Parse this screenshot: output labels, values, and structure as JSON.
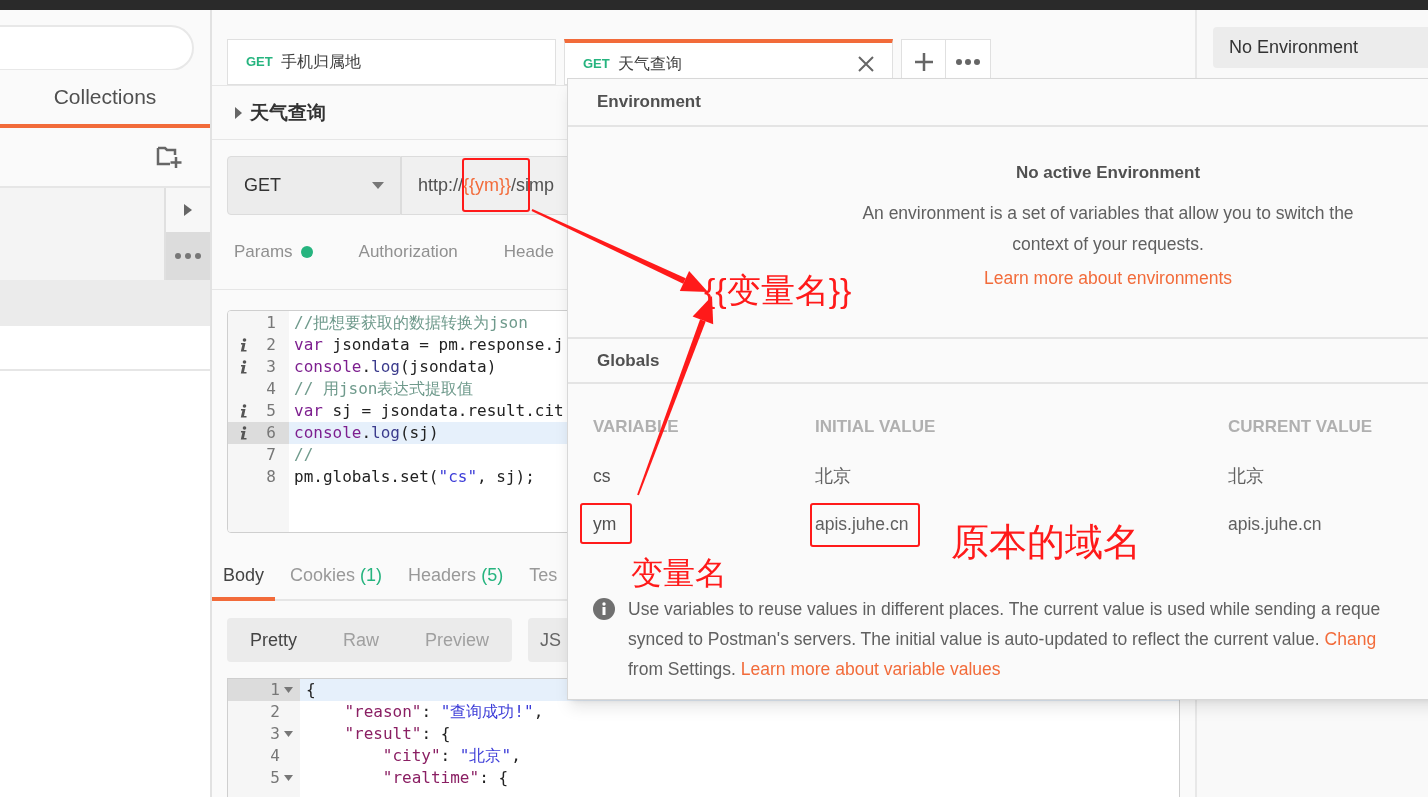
{
  "sidebar": {
    "tab": {
      "label": "Collections",
      "selected": true
    }
  },
  "request_tabs": [
    {
      "method": "GET",
      "name": "手机归属地",
      "selected": false,
      "closable": false
    },
    {
      "method": "GET",
      "name": "天气查询",
      "selected": true,
      "closable": true
    }
  ],
  "request": {
    "name": "天气查询",
    "method": "GET",
    "url_parts": [
      {
        "text": "http://",
        "kind": "plain"
      },
      {
        "text": "{{ym}}",
        "kind": "variable"
      },
      {
        "text": "/simp",
        "kind": "plain"
      }
    ]
  },
  "request_sections": [
    {
      "label": "Params",
      "indicator": true
    },
    {
      "label": "Authorization",
      "indicator": false
    },
    {
      "label": "Heade",
      "indicator": false
    }
  ],
  "script_lines": [
    {
      "number": "1",
      "info": false,
      "active": false,
      "tokens": [
        {
          "text": "//把想要获取的数据转换为json",
          "kind": "comment"
        }
      ]
    },
    {
      "number": "2",
      "info": true,
      "active": false,
      "tokens": [
        {
          "text": "var",
          "kind": "keyword"
        },
        {
          "text": " jsondata = pm.response.j",
          "kind": "plain"
        }
      ]
    },
    {
      "number": "3",
      "info": true,
      "active": false,
      "tokens": [
        {
          "text": "console",
          "kind": "keyword"
        },
        {
          "text": ".",
          "kind": "plain"
        },
        {
          "text": "log",
          "kind": "property"
        },
        {
          "text": "(jsondata)",
          "kind": "plain"
        }
      ]
    },
    {
      "number": "4",
      "info": false,
      "active": false,
      "tokens": [
        {
          "text": "// 用json表达式提取值",
          "kind": "comment"
        }
      ]
    },
    {
      "number": "5",
      "info": true,
      "active": false,
      "tokens": [
        {
          "text": "var",
          "kind": "keyword"
        },
        {
          "text": " sj = jsondata.result.cit",
          "kind": "plain"
        }
      ]
    },
    {
      "number": "6",
      "info": true,
      "active": true,
      "tokens": [
        {
          "text": "console",
          "kind": "keyword"
        },
        {
          "text": ".",
          "kind": "plain"
        },
        {
          "text": "log",
          "kind": "property"
        },
        {
          "text": "(sj)",
          "kind": "plain"
        }
      ]
    },
    {
      "number": "7",
      "info": false,
      "active": false,
      "tokens": [
        {
          "text": "//",
          "kind": "comment"
        }
      ]
    },
    {
      "number": "8",
      "info": false,
      "active": false,
      "tokens": [
        {
          "text": "pm.globals.set(",
          "kind": "plain"
        },
        {
          "text": "\"cs\"",
          "kind": "string"
        },
        {
          "text": ", sj);",
          "kind": "plain"
        }
      ]
    }
  ],
  "response_tabs": [
    {
      "label": "Body",
      "selected": true
    },
    {
      "label": "Cookies",
      "count": "(1)",
      "selected": false
    },
    {
      "label": "Headers",
      "count": "(5)",
      "selected": false
    },
    {
      "label": "Tes",
      "selected": false
    }
  ],
  "view_modes": [
    {
      "label": "Pretty",
      "selected": true
    },
    {
      "label": "Raw",
      "selected": false
    },
    {
      "label": "Preview",
      "selected": false
    }
  ],
  "format": "JS",
  "body_lines": [
    {
      "number": "1",
      "foldable": true,
      "active": true,
      "tokens": [
        {
          "text": "{",
          "kind": "plain"
        }
      ],
      "children": [
        {
          "number": "2",
          "foldable": false,
          "active": false,
          "tokens": [
            {
              "text": "\"reason\"",
              "kind": "key"
            },
            {
              "text": ": ",
              "kind": "plain"
            },
            {
              "text": "\"查询成功!\"",
              "kind": "string"
            },
            {
              "text": ",",
              "kind": "plain"
            }
          ]
        },
        {
          "number": "3",
          "foldable": true,
          "active": false,
          "tokens": [
            {
              "text": "\"result\"",
              "kind": "key"
            },
            {
              "text": ": {",
              "kind": "plain"
            }
          ],
          "children": [
            {
              "number": "4",
              "foldable": false,
              "active": false,
              "tokens": [
                {
                  "text": "\"city\"",
                  "kind": "key"
                },
                {
                  "text": ": ",
                  "kind": "plain"
                },
                {
                  "text": "\"北京\"",
                  "kind": "string"
                },
                {
                  "text": ",",
                  "kind": "plain"
                }
              ]
            },
            {
              "number": "5",
              "foldable": true,
              "active": false,
              "tokens": [
                {
                  "text": "\"realtime\"",
                  "kind": "key"
                },
                {
                  "text": ": {",
                  "kind": "plain"
                }
              ]
            }
          ]
        }
      ]
    }
  ],
  "environment_selector": {
    "value": "No Environment"
  },
  "environment_popup": {
    "title": "Environment",
    "empty_title": "No active Environment",
    "empty_text": "An environment is a set of variables that allow you to switch the context of your requests.",
    "empty_link": "Learn more about environments",
    "globals_title": "Globals",
    "columns": [
      "VARIABLE",
      "INITIAL VALUE",
      "CURRENT VALUE"
    ],
    "rows": [
      [
        "cs",
        "北京",
        "北京"
      ],
      [
        "ym",
        "apis.juhe.cn",
        "apis.juhe.cn"
      ]
    ],
    "info_lines": [
      [
        {
          "text": "Use variables to reuse values in different places. The current value is used while sending a reque",
          "kind": "plain"
        }
      ],
      [
        {
          "text": "synced to Postman's servers. The initial value is auto-updated to reflect the current value. ",
          "kind": "plain"
        },
        {
          "text": "Chang",
          "kind": "link"
        }
      ],
      [
        {
          "text": "from Settings. ",
          "kind": "plain"
        },
        {
          "text": "Learn more about variable values",
          "kind": "link"
        }
      ]
    ]
  },
  "annotations": [
    "{{变量名}}",
    "变量名",
    "原本的域名"
  ]
}
